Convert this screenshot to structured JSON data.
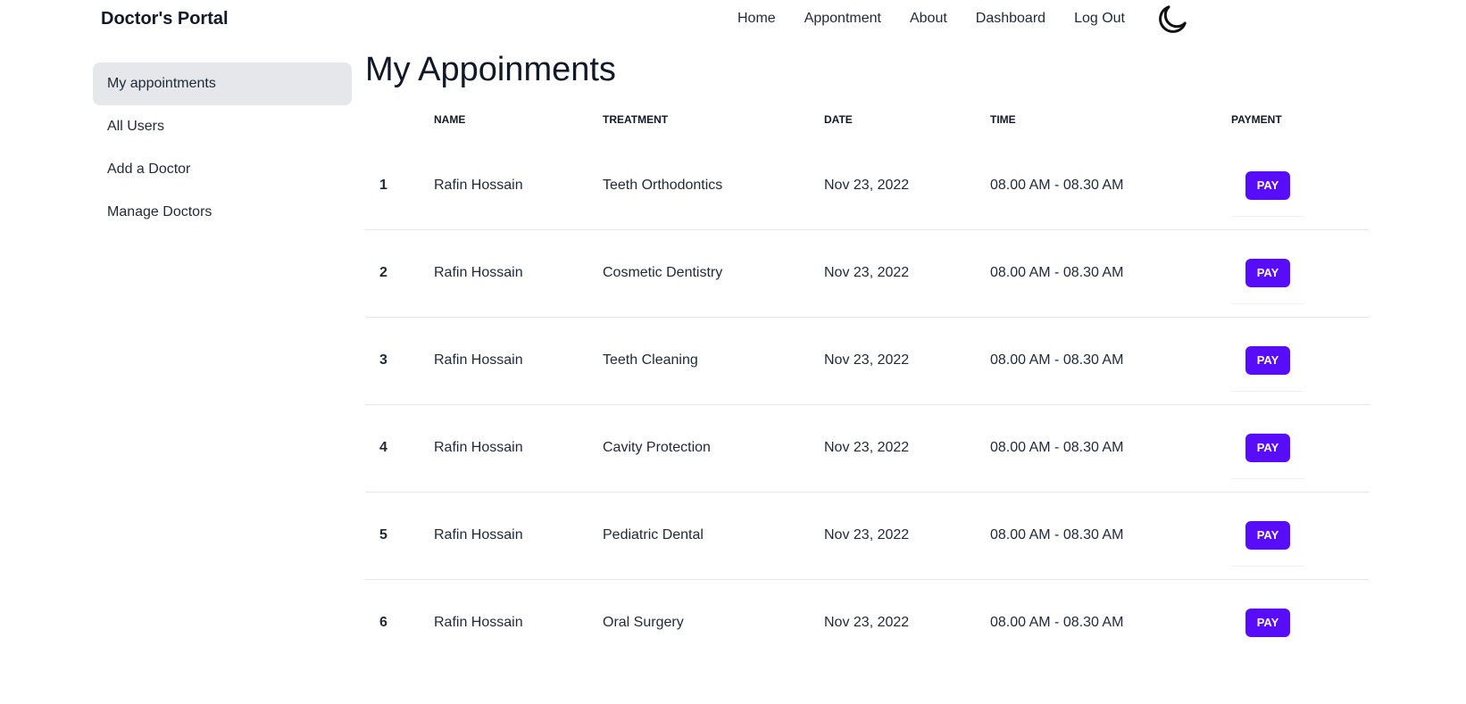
{
  "navbar": {
    "brand": "Doctor's Portal",
    "links": [
      "Home",
      "Appontment",
      "About",
      "Dashboard",
      "Log Out"
    ],
    "theme_icon": "moon-icon"
  },
  "sidebar": {
    "items": [
      {
        "label": "My appointments",
        "active": true
      },
      {
        "label": "All Users"
      },
      {
        "label": "Add a Doctor"
      },
      {
        "label": "Manage Doctors"
      }
    ]
  },
  "main": {
    "title": "My Appoinments",
    "table": {
      "headers": [
        "",
        "Name",
        "Treatment",
        "Date",
        "Time",
        "Payment"
      ],
      "pay_label": "PAY",
      "rows": [
        {
          "index": "1",
          "name": "Rafin Hossain",
          "treatment": "Teeth Orthodontics",
          "date": "Nov 23, 2022",
          "time": "08.00 AM - 08.30 AM"
        },
        {
          "index": "2",
          "name": "Rafin Hossain",
          "treatment": "Cosmetic Dentistry",
          "date": "Nov 23, 2022",
          "time": "08.00 AM - 08.30 AM"
        },
        {
          "index": "3",
          "name": "Rafin Hossain",
          "treatment": "Teeth Cleaning",
          "date": "Nov 23, 2022",
          "time": "08.00 AM - 08.30 AM"
        },
        {
          "index": "4",
          "name": "Rafin Hossain",
          "treatment": "Cavity Protection",
          "date": "Nov 23, 2022",
          "time": "08.00 AM - 08.30 AM"
        },
        {
          "index": "5",
          "name": "Rafin Hossain",
          "treatment": "Pediatric Dental",
          "date": "Nov 23, 2022",
          "time": "08.00 AM - 08.30 AM"
        },
        {
          "index": "6",
          "name": "Rafin Hossain",
          "treatment": "Oral Surgery",
          "date": "Nov 23, 2022",
          "time": "08.00 AM - 08.30 AM"
        }
      ]
    }
  },
  "colors": {
    "primary": "#570df8",
    "active_bg": "#e5e7eb",
    "divider": "#e5e7eb"
  }
}
